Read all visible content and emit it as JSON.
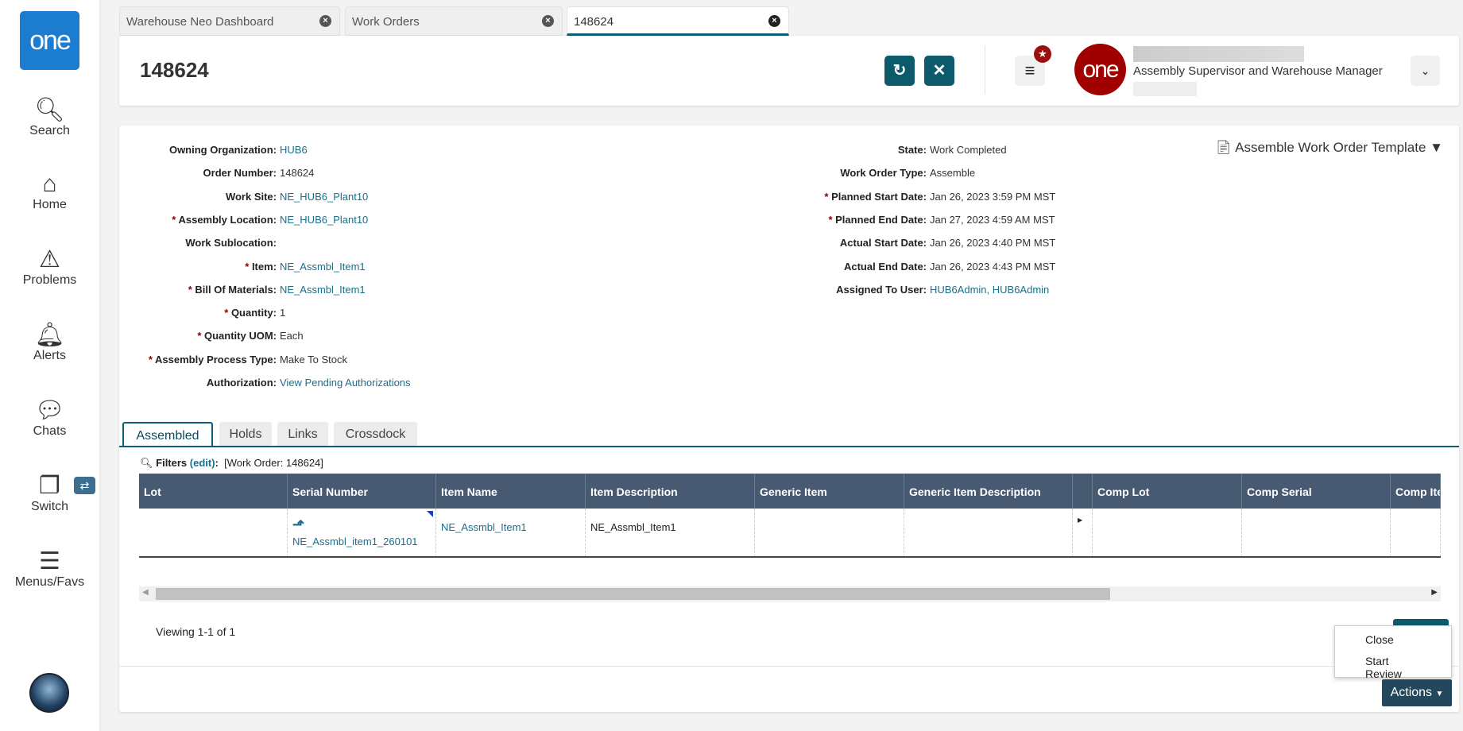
{
  "sidebar": {
    "logo": "one",
    "items": [
      {
        "label": "Search"
      },
      {
        "label": "Home"
      },
      {
        "label": "Problems"
      },
      {
        "label": "Alerts"
      },
      {
        "label": "Chats"
      },
      {
        "label": "Switch"
      },
      {
        "label": "Menus/Favs"
      }
    ]
  },
  "tabs": [
    {
      "label": "Warehouse Neo Dashboard"
    },
    {
      "label": "Work Orders"
    },
    {
      "label": "148624"
    }
  ],
  "header": {
    "title": "148624",
    "user_role": "Assembly Supervisor and Warehouse Manager",
    "avatar_text": "one"
  },
  "template_label": "Assemble Work Order Template",
  "left_fields": [
    {
      "label": "Owning Organization:",
      "value": "HUB6",
      "req": false,
      "link": true
    },
    {
      "label": "Order Number:",
      "value": "148624",
      "req": false,
      "link": false
    },
    {
      "label": "Work Site:",
      "value": "NE_HUB6_Plant10",
      "req": false,
      "link": true
    },
    {
      "label": "Assembly Location:",
      "value": "NE_HUB6_Plant10",
      "req": true,
      "link": true
    },
    {
      "label": "Work Sublocation:",
      "value": "",
      "req": false,
      "link": false
    },
    {
      "label": "Item:",
      "value": "NE_Assmbl_Item1",
      "req": true,
      "link": true
    },
    {
      "label": "Bill Of Materials:",
      "value": "NE_Assmbl_Item1",
      "req": true,
      "link": true
    },
    {
      "label": "Quantity:",
      "value": "1",
      "req": true,
      "link": false
    },
    {
      "label": "Quantity UOM:",
      "value": "Each",
      "req": true,
      "link": false
    },
    {
      "label": "Assembly Process Type:",
      "value": "Make To Stock",
      "req": true,
      "link": false
    },
    {
      "label": "Authorization:",
      "value": "View Pending Authorizations",
      "req": false,
      "link": true
    }
  ],
  "right_fields": [
    {
      "label": "State:",
      "value": "Work Completed",
      "req": false,
      "link": false
    },
    {
      "label": "Work Order Type:",
      "value": "Assemble",
      "req": false,
      "link": false
    },
    {
      "label": "Planned Start Date:",
      "value": "Jan 26, 2023 3:59 PM MST",
      "req": true,
      "link": false
    },
    {
      "label": "Planned End Date:",
      "value": "Jan 27, 2023 4:59 AM MST",
      "req": true,
      "link": false
    },
    {
      "label": "Actual Start Date:",
      "value": "Jan 26, 2023 4:40 PM MST",
      "req": false,
      "link": false
    },
    {
      "label": "Actual End Date:",
      "value": "Jan 26, 2023 4:43 PM MST",
      "req": false,
      "link": false
    },
    {
      "label": "Assigned To User:",
      "value": "HUB6Admin, HUB6Admin",
      "req": false,
      "link": true
    }
  ],
  "subtabs": [
    {
      "label": "Assembled"
    },
    {
      "label": "Holds"
    },
    {
      "label": "Links"
    },
    {
      "label": "Crossdock"
    }
  ],
  "filters": {
    "label": "Filters",
    "edit": "(edit)",
    "colon": ":",
    "value": "[Work Order: 148624]"
  },
  "table": {
    "columns": [
      "Lot",
      "Serial Number",
      "Item Name",
      "Item Description",
      "Generic Item",
      "Generic Item Description",
      "",
      "Comp Lot",
      "Comp Serial",
      "Comp Item"
    ],
    "rows": [
      {
        "lot": "",
        "serial": "NE_Assmbl_item1_260101",
        "item_name": "NE_Assmbl_Item1",
        "item_desc": "NE_Assmbl_Item1"
      }
    ]
  },
  "viewing": "Viewing 1-1 of 1",
  "actions": {
    "label": "Actions",
    "menu": [
      "Close",
      "Start Review"
    ]
  }
}
